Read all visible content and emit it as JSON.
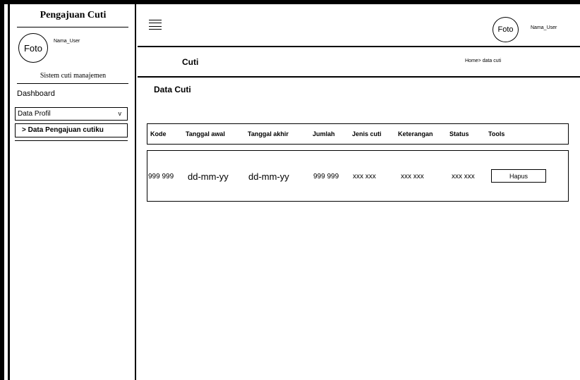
{
  "sidebar": {
    "app_title": "Pengajuan Cuti",
    "avatar_label": "Foto",
    "username": "Nama_User",
    "subtitle": "Sistem cuti manajemen",
    "nav": {
      "dashboard": "Dashboard",
      "data_profil": "Data Profil",
      "data_profil_chevron": "v",
      "data_pengajuan": "> Data Pengajuan cutiku"
    }
  },
  "topbar": {
    "menu_icon": "hamburger-icon",
    "avatar_label": "Foto",
    "username": "Nama_User"
  },
  "page_header": {
    "title": "Cuti",
    "breadcrumb": "Home> data cuti"
  },
  "main": {
    "section_title": "Data Cuti",
    "table": {
      "columns": [
        "Kode",
        "Tanggal  awal",
        "Tanggal akhir",
        "Jumlah",
        "Jenis cuti",
        "Keterangan",
        "Status",
        "Tools"
      ],
      "rows": [
        {
          "kode": "999 999",
          "tanggal_awal": "dd-mm-yy",
          "tanggal_akhir": "dd-mm-yy",
          "jumlah": "999 999",
          "jenis_cuti": "xxx xxx",
          "keterangan": "xxx xxx",
          "status": "xxx xxx",
          "tools_button": "Hapus"
        }
      ]
    }
  }
}
